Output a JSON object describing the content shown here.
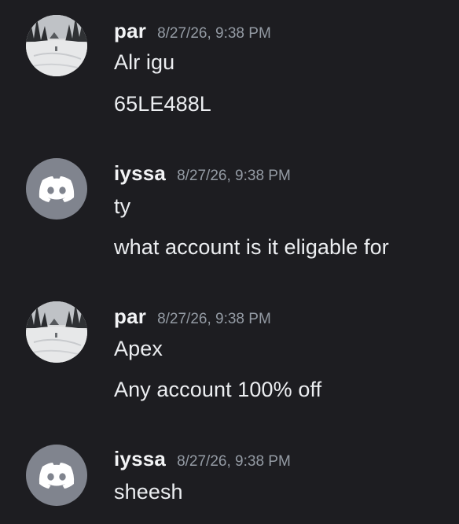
{
  "colors": {
    "background": "#1d1d21",
    "username": "#f2f3f5",
    "timestamp": "#949ba4",
    "message_text": "#eceef1",
    "discord_avatar_bg": "#80848e"
  },
  "messages": [
    {
      "author": "par",
      "timestamp": "8/27/26, 9:38 PM",
      "avatar": "snowy-forest-photo",
      "lines": [
        "Alr igu",
        "65LE488L"
      ]
    },
    {
      "author": "iyssa",
      "timestamp": "8/27/26, 9:38 PM",
      "avatar": "discord-default-icon",
      "lines": [
        "ty",
        "what account is it eligable for"
      ]
    },
    {
      "author": "par",
      "timestamp": "8/27/26, 9:38 PM",
      "avatar": "snowy-forest-photo",
      "lines": [
        "Apex",
        "Any account 100% off"
      ]
    },
    {
      "author": "iyssa",
      "timestamp": "8/27/26, 9:38 PM",
      "avatar": "discord-default-icon",
      "lines": [
        "sheesh"
      ]
    }
  ]
}
